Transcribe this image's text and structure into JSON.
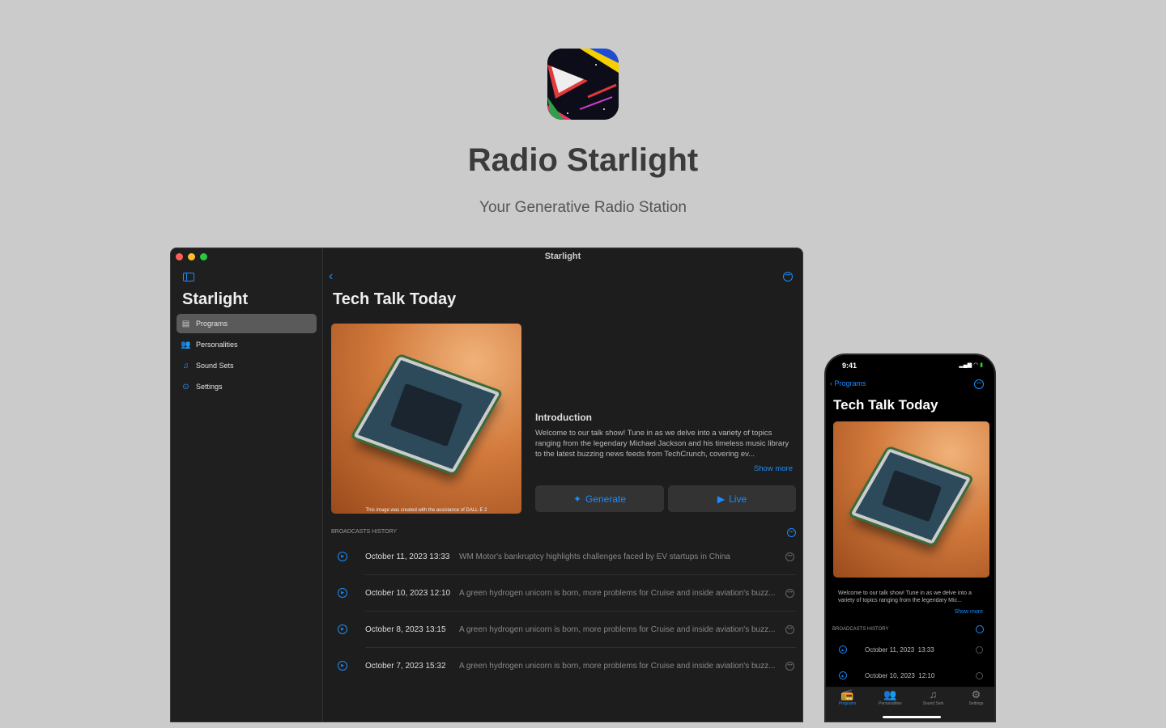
{
  "hero": {
    "app_icon": "radio-dish-starlight-icon",
    "title": "Radio Starlight",
    "subtitle": "Your Generative Radio Station"
  },
  "colors": {
    "accent": "#1a8cff",
    "background": "#cbcbcb",
    "window": "#1d1d1d"
  },
  "mac": {
    "window_title": "Starlight",
    "sidebar": {
      "title": "Starlight",
      "items": [
        {
          "label": "Programs",
          "icon": "radio-icon",
          "selected": true
        },
        {
          "label": "Personalities",
          "icon": "people-icon"
        },
        {
          "label": "Sound Sets",
          "icon": "music-list-icon"
        },
        {
          "label": "Settings",
          "icon": "gear-icon"
        }
      ]
    },
    "main": {
      "title": "Tech Talk Today",
      "image_caption": "This image was created with the assistance of DALL·E 2",
      "intro_heading": "Introduction",
      "intro_text": "Welcome to our talk show! Tune in as we delve into a variety of topics ranging from the legendary Michael Jackson and his timeless music library to the latest buzzing news feeds from TechCrunch, covering ev...",
      "show_more": "Show more",
      "generate": "Generate",
      "live": "Live",
      "history_heading": "BROADCASTS HISTORY",
      "history": [
        {
          "date": "October 11, 2023  13:33",
          "desc": "WM Motor's bankruptcy highlights challenges faced by EV startups in China"
        },
        {
          "date": "October 10, 2023  12:10",
          "desc": "A green hydrogen unicorn is born, more problems for Cruise and inside aviation's buzz..."
        },
        {
          "date": "October 8, 2023  13:15",
          "desc": "A green hydrogen unicorn is born, more problems for Cruise and inside aviation's buzz..."
        },
        {
          "date": "October 7, 2023  15:32",
          "desc": "A green hydrogen unicorn is born, more problems for Cruise and inside aviation's buzz..."
        }
      ]
    }
  },
  "phone": {
    "time": "9:41",
    "back": "Programs",
    "title": "Tech Talk Today",
    "intro_text": "Welcome to our talk show! Tune in as we delve into a variety of topics ranging from the legendary Mic...",
    "show_more": "Show more",
    "history_heading": "BROADCASTS HISTORY",
    "history": [
      {
        "date": "October 11, 2023  13:33"
      },
      {
        "date": "October 10, 2023  12:10"
      }
    ],
    "tabs": [
      {
        "label": "Programs",
        "icon": "radio-icon",
        "selected": true
      },
      {
        "label": "Personalities",
        "icon": "people-icon"
      },
      {
        "label": "Sound Sets",
        "icon": "music-list-icon"
      },
      {
        "label": "Settings",
        "icon": "gear-icon"
      }
    ]
  }
}
